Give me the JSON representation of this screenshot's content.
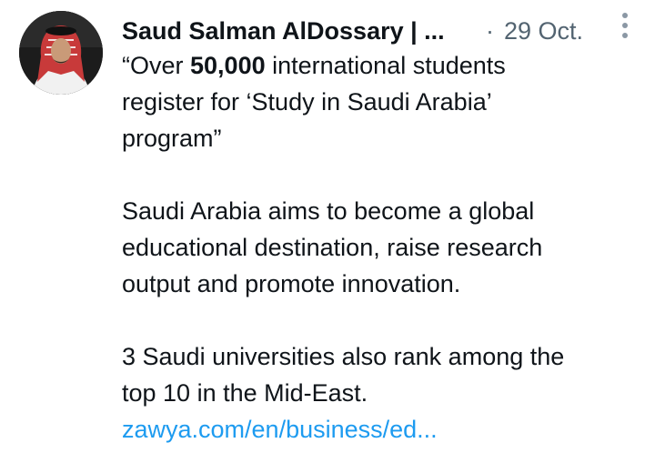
{
  "tweet": {
    "author_name": "Saud Salman AlDossary | ...",
    "separator": "·",
    "date": "29 Oct.",
    "avatar_alt": "profile avatar",
    "paragraph1": {
      "line1_prefix": "“Over ",
      "line1_bold": "50,000",
      "line1_suffix": " international students",
      "line2": "register for ‘Study in Saudi Arabia’",
      "line3": "program”"
    },
    "paragraph2": {
      "line1": "Saudi Arabia aims to become a global",
      "line2": "educational destination, raise research",
      "line3": "output and promote innovation."
    },
    "paragraph3": {
      "line1": "3 Saudi universities also rank among the",
      "line2": "top 10 in the Mid-East."
    },
    "link_text": "zawya.com/en/business/ed...",
    "icons": {
      "more": "more-vertical-icon"
    },
    "colors": {
      "text": "#0f1419",
      "secondary": "#536471",
      "link": "#1d9bf0"
    }
  }
}
